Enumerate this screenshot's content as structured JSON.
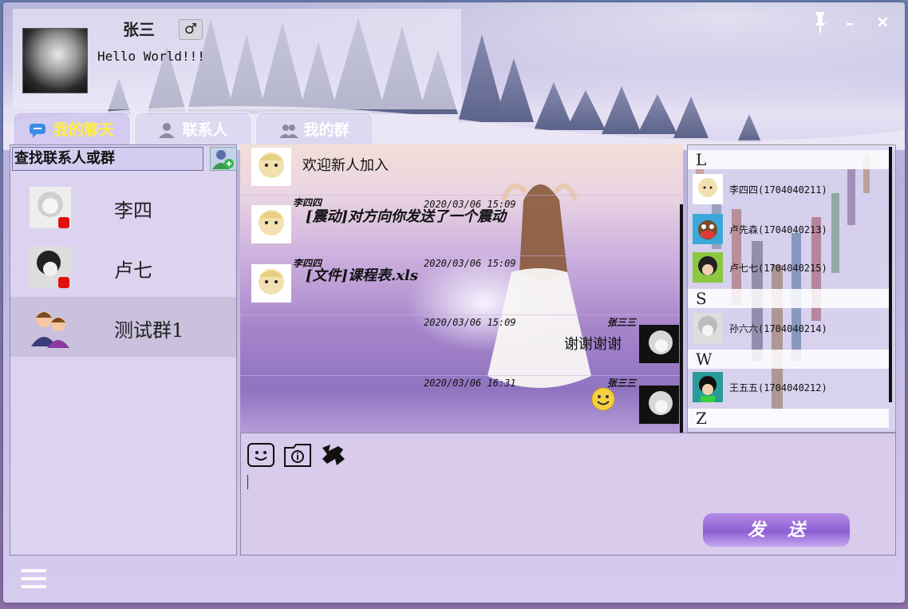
{
  "profile": {
    "username": "张三",
    "gender_symbol": "♂",
    "signature": "Hello World!!!"
  },
  "window_controls": {
    "pin": "pin-icon",
    "minimize": "–",
    "close": "×"
  },
  "tabs": [
    {
      "label": "我的聊天",
      "icon": "chat-bubble-icon",
      "active": true
    },
    {
      "label": "联系人",
      "icon": "person-icon",
      "active": false
    },
    {
      "label": "我的群",
      "icon": "group-icon",
      "active": false
    }
  ],
  "search": {
    "placeholder": "查找联系人或群"
  },
  "chat_list": [
    {
      "name": "李四",
      "avatar": "user-avatar",
      "selected": false
    },
    {
      "name": "卢七",
      "avatar": "user-avatar",
      "selected": false
    },
    {
      "name": "测试群1",
      "avatar": "group-avatar",
      "selected": true
    }
  ],
  "messages": [
    {
      "side": "left",
      "sender": "",
      "time": "",
      "text": "欢迎新人加入",
      "special": false
    },
    {
      "side": "left",
      "sender": "李四四",
      "time": "2020/03/06 15:09",
      "text": "[震动]对方向你发送了一个震动",
      "special": true
    },
    {
      "side": "left",
      "sender": "李四四",
      "time": "2020/03/06 15:09",
      "text": "[文件]课程表.xls",
      "special": true
    },
    {
      "side": "right",
      "sender": "张三三",
      "time": "2020/03/06 15:09",
      "text": "谢谢谢谢",
      "special": false
    },
    {
      "side": "right",
      "sender": "张三三",
      "time": "2020/03/06 16:31",
      "text": "",
      "emoji": "smile-emoji",
      "special": false
    }
  ],
  "contacts": {
    "groups": [
      {
        "letter": "L",
        "items": [
          "李四四(1704040211)",
          "卢先森(1704040213)",
          "卢七七(1704040215)"
        ]
      },
      {
        "letter": "S",
        "items": [
          "孙六六(1704040214)"
        ]
      },
      {
        "letter": "W",
        "items": [
          "王五五(1704040212)"
        ]
      },
      {
        "letter": "Z",
        "items": []
      }
    ]
  },
  "input": {
    "tools": [
      "emoji-icon",
      "file-icon",
      "shake-icon"
    ],
    "send_label": "发送"
  },
  "colors": {
    "active_tab": "#ffee44",
    "send_button": "#8e5fd4",
    "panel_bg": "#dcd3f0"
  }
}
